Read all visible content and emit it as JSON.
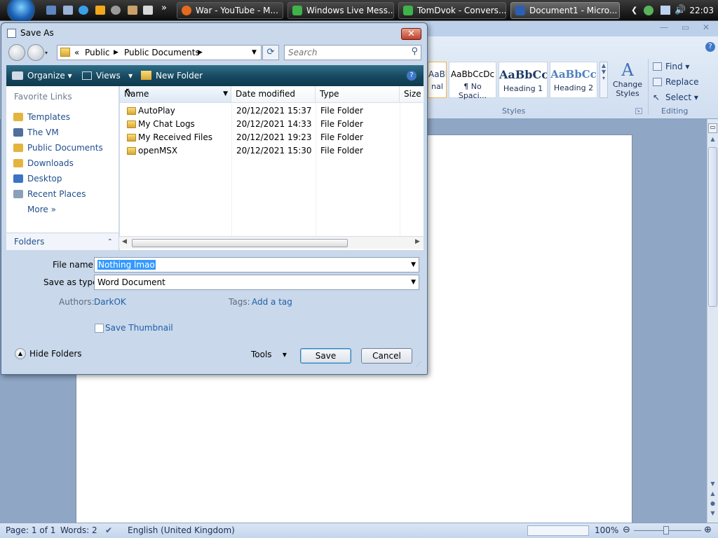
{
  "taskbar": {
    "buttons": [
      {
        "label": "War - YouTube - M..."
      },
      {
        "label": "Windows Live Mess..."
      },
      {
        "label": "TomDvok - Convers..."
      },
      {
        "label": "Document1 - Micro..."
      }
    ],
    "clock": "22:03",
    "overflow": "»"
  },
  "word": {
    "styles": [
      {
        "sample": "AaBbCcDc",
        "label": "nal"
      },
      {
        "sample": "AaBbCcDc",
        "label": "¶ No Spaci..."
      },
      {
        "sample": "AaBbCc",
        "label": "Heading 1"
      },
      {
        "sample": "AaBbCc",
        "label": "Heading 2"
      }
    ],
    "change_styles": "Change Styles",
    "styles_group": "Styles",
    "editing": {
      "find": "Find",
      "replace": "Replace",
      "select": "Select",
      "group": "Editing"
    },
    "status": {
      "page": "Page: 1 of 1",
      "words": "Words: 2",
      "language": "English (United Kingdom)",
      "zoom": "100%"
    }
  },
  "dialog": {
    "title": "Save As",
    "close": "✕",
    "address": {
      "prefix": "«",
      "parts": [
        "Public",
        "Public Documents"
      ]
    },
    "search_placeholder": "Search",
    "toolbar": {
      "organize": "Organize",
      "views": "Views",
      "new_folder": "New Folder",
      "help": "?"
    },
    "favorite_links_title": "Favorite Links",
    "favorites": [
      {
        "label": "Templates",
        "icon": "folder-icon",
        "color": "#e3b53e"
      },
      {
        "label": "The VM",
        "icon": "computer-icon",
        "color": "#4f6f9c"
      },
      {
        "label": "Public Documents",
        "icon": "folder-icon",
        "color": "#e3b53e"
      },
      {
        "label": "Downloads",
        "icon": "folder-icon",
        "color": "#e3b53e"
      },
      {
        "label": "Desktop",
        "icon": "desktop-icon",
        "color": "#3c73c4"
      },
      {
        "label": "Recent Places",
        "icon": "recent-places-icon",
        "color": "#8aa0b8"
      },
      {
        "label": "More",
        "icon": "chevron-double-right-icon",
        "color": "#1f4e8c"
      }
    ],
    "more_chevron": "»",
    "folders_label": "Folders",
    "columns": [
      "Name",
      "Date modified",
      "Type",
      "Size"
    ],
    "files": [
      {
        "name": "AutoPlay",
        "date": "20/12/2021 15:37",
        "type": "File Folder"
      },
      {
        "name": "My Chat Logs",
        "date": "20/12/2021 14:33",
        "type": "File Folder"
      },
      {
        "name": "My Received Files",
        "date": "20/12/2021 19:23",
        "type": "File Folder"
      },
      {
        "name": "openMSX",
        "date": "20/12/2021 15:30",
        "type": "File Folder"
      }
    ],
    "filename_label": "File name:",
    "filename_value": "Nothing lmao",
    "savetype_label": "Save as type:",
    "savetype_value": "Word Document",
    "authors_label": "Authors:",
    "authors_value": "DarkOK",
    "tags_label": "Tags:",
    "tags_value": "Add a tag",
    "save_thumbnail": "Save Thumbnail",
    "hide_folders": "Hide Folders",
    "tools": "Tools",
    "save": "Save",
    "cancel": "Cancel"
  }
}
